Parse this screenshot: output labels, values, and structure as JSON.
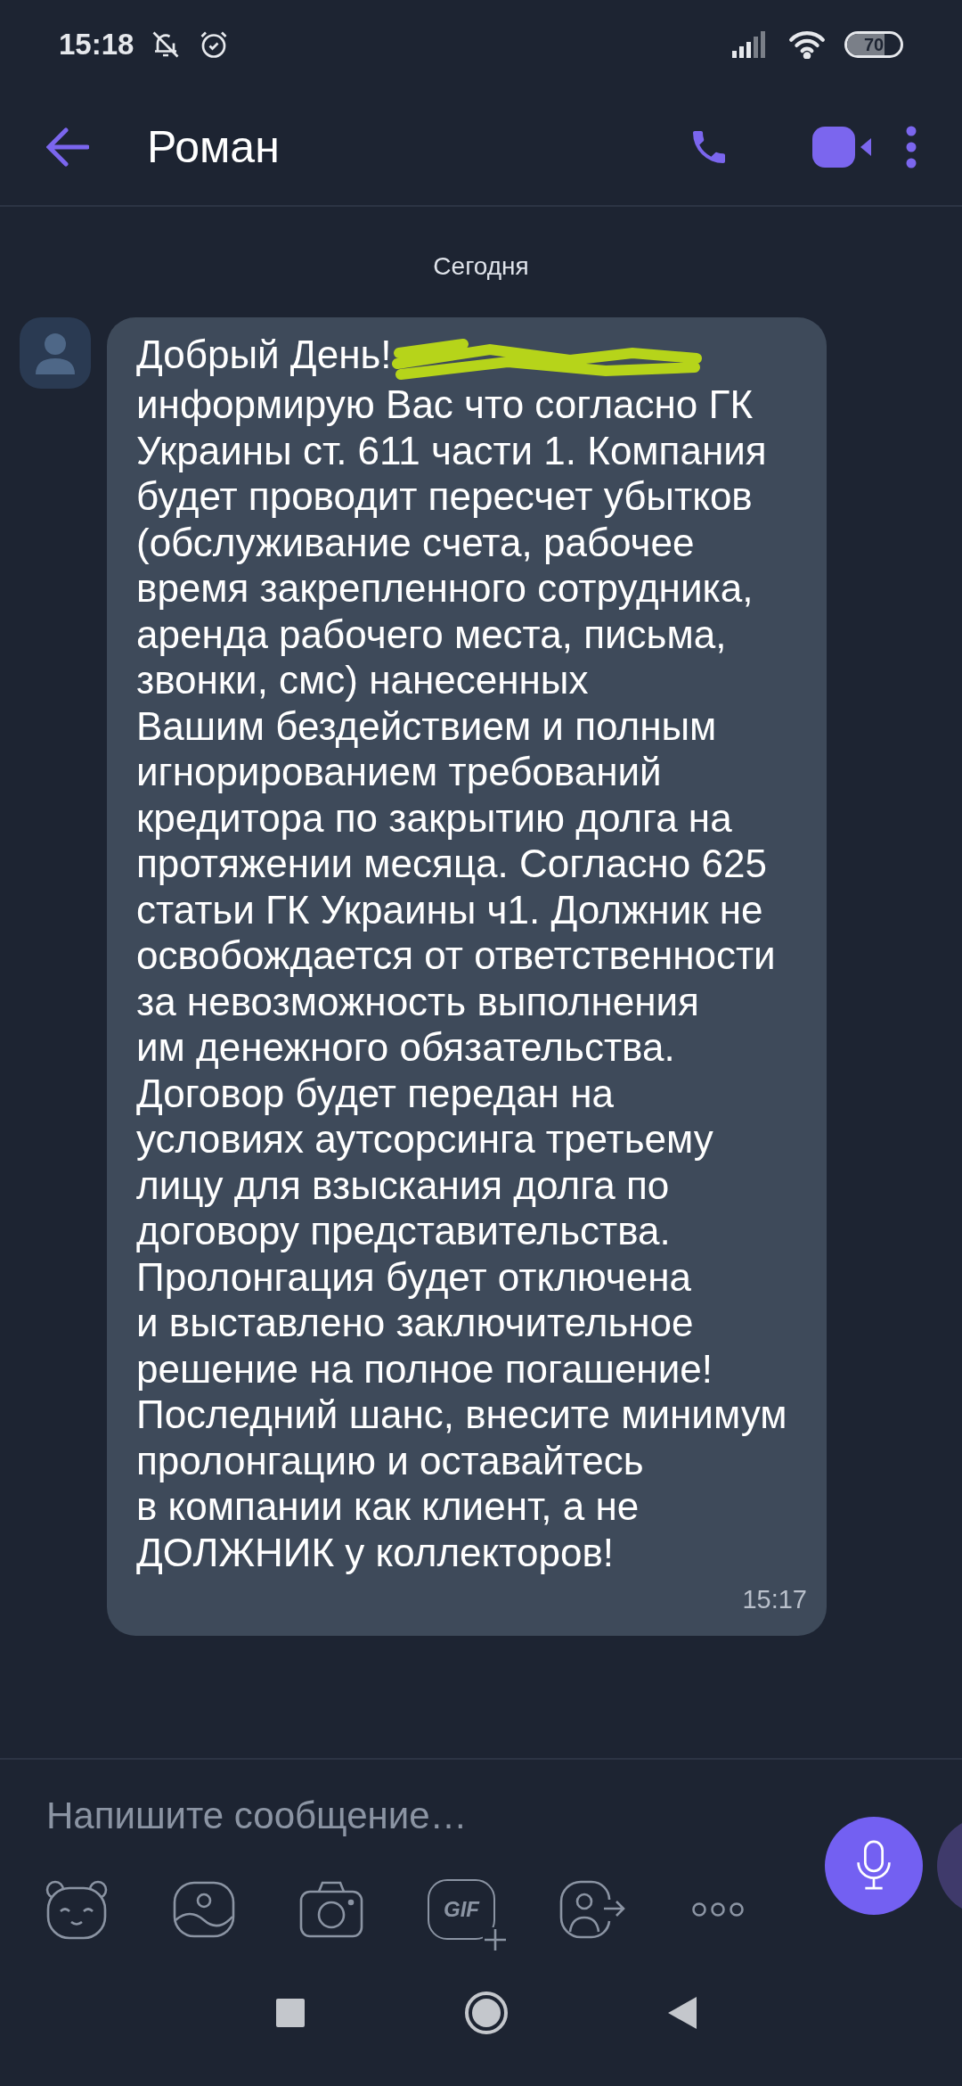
{
  "status_bar": {
    "time": "15:18",
    "battery": "70"
  },
  "header": {
    "title": "Роман"
  },
  "date_divider": "Сегодня",
  "messages": [
    {
      "lines": [
        "Добрый День!",
        "информирую Вас что согласно ГК",
        "Украины ст. 611 части 1. Компания",
        "будет проводит пересчет убытков",
        "(обслуживание счета, рабочее",
        "время закрепленного сотрудника,",
        "аренда рабочего места, письма,",
        "звонки, смс) нанесенных",
        "Вашим бездействием и полным",
        "игнорированием требований",
        "кредитора по закрытию долга на",
        "протяжении месяца. Согласно 625",
        "статьи ГК Украины ч1. Должник не",
        "освобождается от ответственности",
        "за невозможность выполнения",
        "им денежного обязательства.",
        "Договор будет передан на",
        "условиях аутсорсинга третьему",
        "лицу для взыскания долга по",
        "договору представительства.",
        "Пролонгация будет отключена",
        "и выставлено заключительное",
        "решение на полное погашение!",
        "Последний шанс, внесите минимум",
        "пролонгацию и оставайтесь",
        "в компании как клиент, а не",
        "ДОЛЖНИК у коллекторов!"
      ],
      "time": "15:17",
      "redacted": true
    }
  ],
  "composer": {
    "placeholder": "Напишите сообщение…",
    "gif_label": "GIF"
  }
}
